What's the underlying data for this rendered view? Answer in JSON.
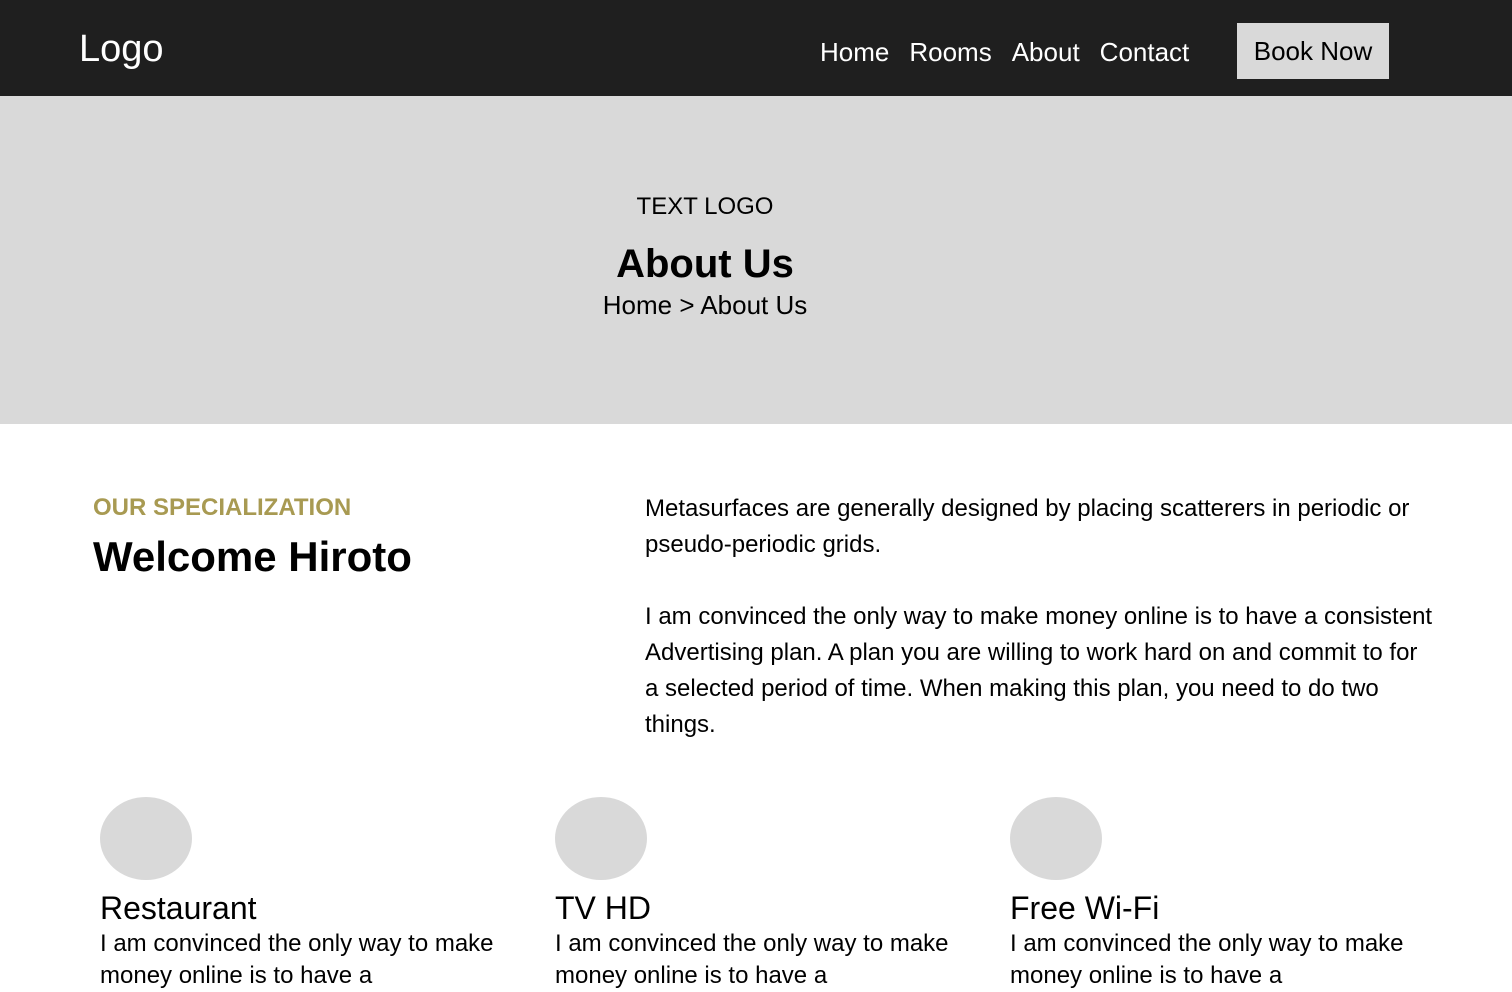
{
  "nav": {
    "logo": "Logo",
    "links": [
      "Home",
      "Rooms",
      "About",
      "Contact"
    ],
    "cta": "Book Now"
  },
  "hero": {
    "text_logo": "TEXT LOGO",
    "title": "About Us",
    "breadcrumb": [
      "Home",
      ">",
      "About Us"
    ]
  },
  "intro": {
    "eyebrow": "OUR SPECIALIZATION",
    "heading": "Welcome Hiroto",
    "paragraphs": [
      "Metasurfaces are generally designed by placing scatterers in periodic or pseudo-periodic grids.",
      "I am convinced the only way to make money online is to have a consistent Advertising plan. A plan you are willing to work hard on and commit to for a selected period of time. When making this plan, you need to do two things."
    ]
  },
  "features": [
    {
      "icon": "restaurant-icon",
      "title": "Restaurant",
      "text": "I am convinced the only way to make money online is to have a"
    },
    {
      "icon": "tv-icon",
      "title": "TV HD",
      "text": "I am convinced the only way to make money online is to have a"
    },
    {
      "icon": "wifi-icon",
      "title": "Free Wi-Fi",
      "text": "I am convinced the only way to make money online is to have a"
    }
  ],
  "colors": {
    "navbar": "#1f1f1f",
    "placeholder": "#d9d9d9",
    "accent": "#a89a52"
  }
}
